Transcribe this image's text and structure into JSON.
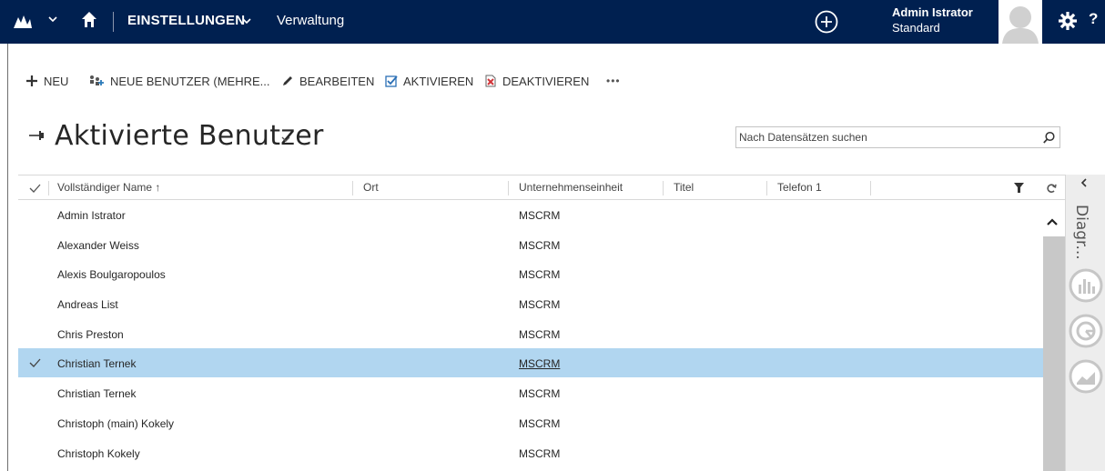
{
  "nav": {
    "area_label": "EINSTELLUNGEN",
    "sub_label": "Verwaltung",
    "user_name": "Admin Istrator",
    "user_role": "Standard",
    "help_label": "?"
  },
  "commands": [
    {
      "label": "NEU",
      "icon": "plus-icon"
    },
    {
      "label": "NEUE BENUTZER (MEHRE...",
      "icon": "add-users-icon"
    },
    {
      "label": "BEARBEITEN",
      "icon": "pencil-icon"
    },
    {
      "label": "AKTIVIEREN",
      "icon": "activate-icon"
    },
    {
      "label": "DEAKTIVIEREN",
      "icon": "deactivate-icon"
    },
    {
      "label": "•••",
      "icon": "more-icon"
    }
  ],
  "view": {
    "title": "Aktivierte Benutzer"
  },
  "search": {
    "placeholder": "Nach Datensätzen suchen"
  },
  "grid": {
    "columns": {
      "name": "Vollständiger Name ↑",
      "ort": "Ort",
      "business_unit": "Unternehmenseinheit",
      "titel": "Titel",
      "telefon": "Telefon 1"
    },
    "rows": [
      {
        "name": "Admin Istrator",
        "business_unit": "MSCRM",
        "selected": false
      },
      {
        "name": "Alexander Weiss",
        "business_unit": "MSCRM",
        "selected": false
      },
      {
        "name": "Alexis Boulgaropoulos",
        "business_unit": "MSCRM",
        "selected": false
      },
      {
        "name": "Andreas List",
        "business_unit": "MSCRM",
        "selected": false
      },
      {
        "name": "Chris Preston",
        "business_unit": "MSCRM",
        "selected": false
      },
      {
        "name": "Christian Ternek",
        "business_unit": "MSCRM",
        "selected": true
      },
      {
        "name": "Christian Ternek",
        "business_unit": "MSCRM",
        "selected": false
      },
      {
        "name": "Christoph (main) Kokely",
        "business_unit": "MSCRM",
        "selected": false
      },
      {
        "name": "Christoph Kokely",
        "business_unit": "MSCRM",
        "selected": false
      }
    ]
  },
  "chart_pane": {
    "label": "Diagr..."
  },
  "colors": {
    "nav_background": "#002050",
    "selected_row": "#b1d6f0",
    "pane_background": "#ededed"
  }
}
